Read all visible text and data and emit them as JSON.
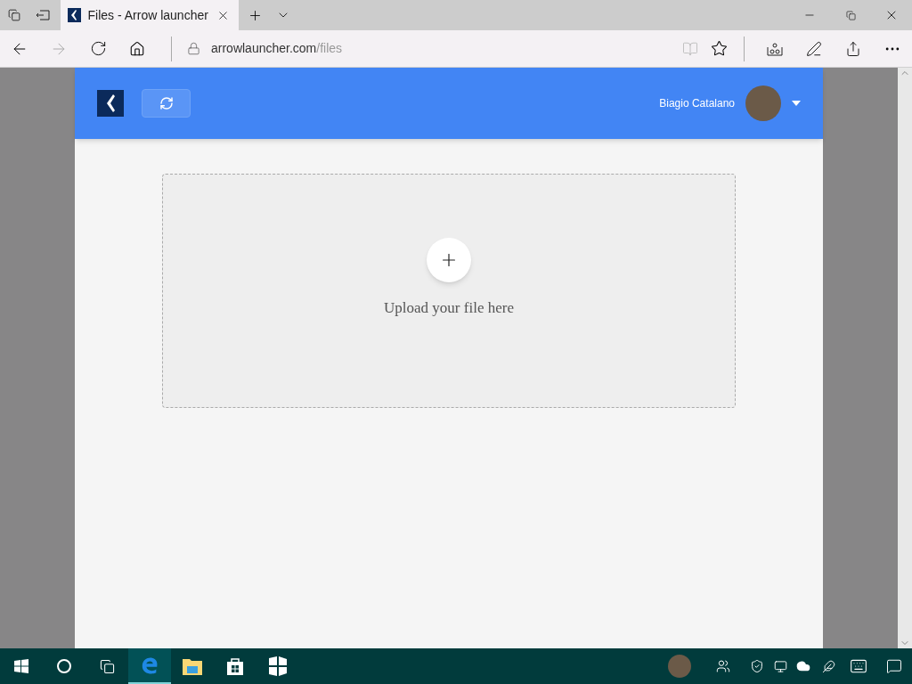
{
  "browser": {
    "tabs": [
      {
        "title": "Files - Arrow launcher",
        "selected": true
      }
    ],
    "address": {
      "domain": "arrowlauncher.com",
      "path": "/files"
    }
  },
  "header": {
    "user_name": "Biagio Catalano"
  },
  "upload": {
    "label": "Upload your file here"
  },
  "taskbar": {
    "apps": [
      {
        "kind": "edge",
        "selected": true
      },
      {
        "kind": "explorer",
        "selected": false
      },
      {
        "kind": "store",
        "selected": false
      },
      {
        "kind": "tiles",
        "selected": false
      }
    ]
  }
}
